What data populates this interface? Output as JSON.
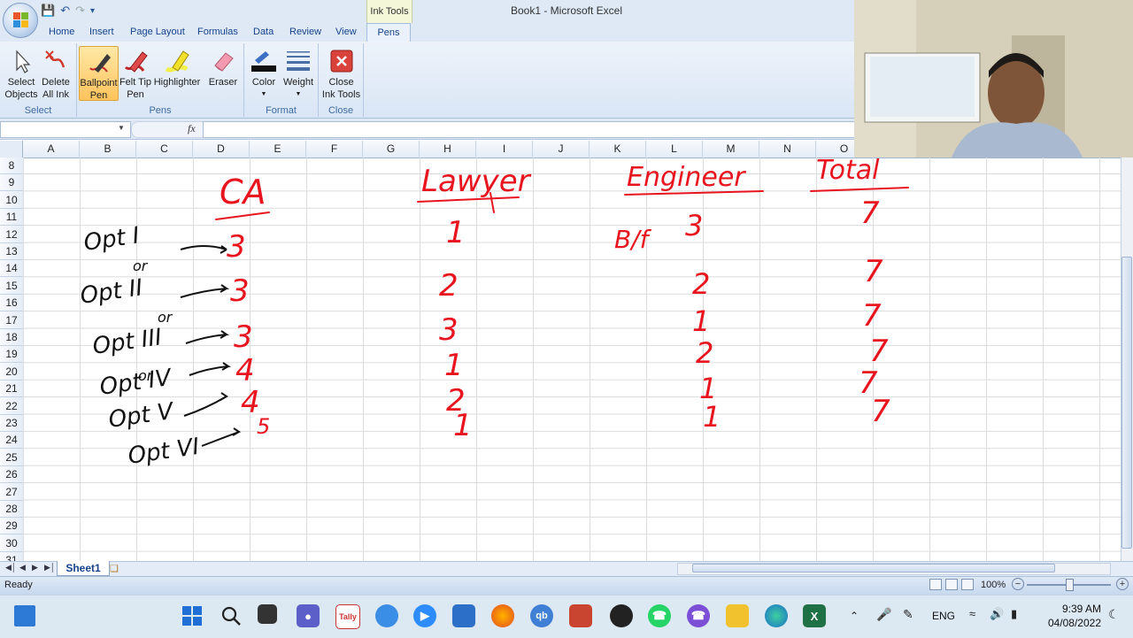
{
  "window": {
    "title": "Book1 - Microsoft Excel",
    "context_tab_group": "Ink Tools"
  },
  "tabs": [
    "Home",
    "Insert",
    "Page Layout",
    "Formulas",
    "Data",
    "Review",
    "View"
  ],
  "active_tab": "Pens",
  "ribbon": {
    "groups": [
      {
        "label": "Select",
        "buttons": [
          {
            "label": "Select\nObjects",
            "icon": "arrow-icon"
          },
          {
            "label": "Delete\nAll Ink",
            "icon": "delete-ink-icon"
          }
        ]
      },
      {
        "label": "Pens",
        "buttons": [
          {
            "label": "Ballpoint\nPen",
            "icon": "ballpoint-pen-icon",
            "selected": true
          },
          {
            "label": "Felt Tip\nPen",
            "icon": "felt-tip-pen-icon"
          },
          {
            "label": "Highlighter",
            "icon": "highlighter-icon"
          },
          {
            "label": "Eraser",
            "icon": "eraser-icon"
          }
        ]
      },
      {
        "label": "Format",
        "buttons": [
          {
            "label": "Color",
            "icon": "color-icon"
          },
          {
            "label": "Weight",
            "icon": "weight-icon"
          }
        ]
      },
      {
        "label": "Close",
        "buttons": [
          {
            "label": "Close\nInk Tools",
            "icon": "close-ink-icon"
          }
        ]
      }
    ]
  },
  "formula_bar": {
    "fx": "fx"
  },
  "columns": [
    "A",
    "B",
    "C",
    "D",
    "E",
    "F",
    "G",
    "H",
    "I",
    "J",
    "K",
    "L",
    "M",
    "N",
    "O"
  ],
  "rows": [
    "8",
    "9",
    "10",
    "11",
    "12",
    "13",
    "14",
    "15",
    "16",
    "17",
    "18",
    "19",
    "20",
    "21",
    "22",
    "23",
    "24",
    "25",
    "26",
    "27",
    "28",
    "29",
    "30",
    "31"
  ],
  "sheet": {
    "tab": "Sheet1"
  },
  "status": {
    "ready": "Ready",
    "zoom": "100%"
  },
  "ink": {
    "col_ca": "CA",
    "col_lawyer": "Lawyer",
    "col_engineer": "Engineer",
    "col_total": "Total",
    "bf": "B/f",
    "options": [
      "Opt I",
      "Opt II",
      "Opt III",
      "Opt IV",
      "Opt V",
      "Opt VI"
    ],
    "or": "or",
    "ca_values": [
      "3",
      "3",
      "3",
      "4",
      "4",
      "5"
    ],
    "lawyer_values": [
      "1",
      "2",
      "3",
      "1",
      "2",
      "1"
    ],
    "engineer_values": [
      "3",
      "2",
      "1",
      "2",
      "1",
      "1"
    ],
    "total_values": [
      "7",
      "7",
      "7",
      "7",
      "7",
      "7"
    ],
    "ink_color": "#e8141e"
  },
  "taskbar": {
    "lang": "ENG",
    "time": "9:39 AM",
    "date": "04/08/2022"
  }
}
